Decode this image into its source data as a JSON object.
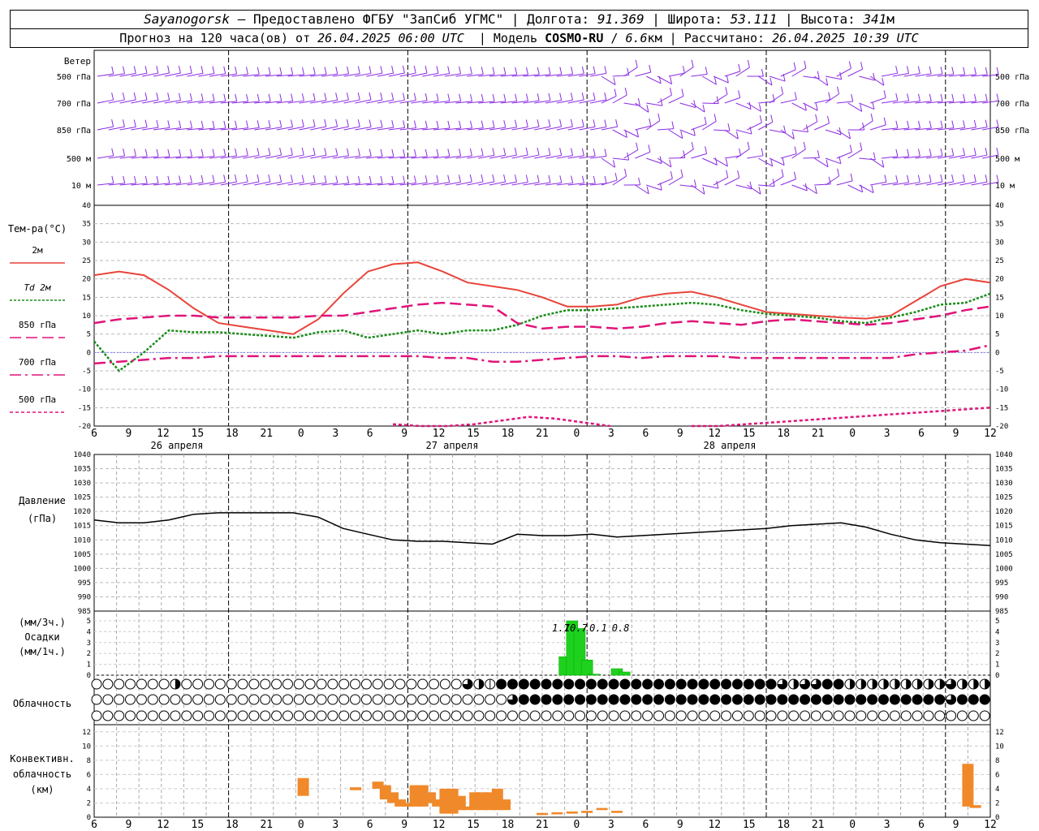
{
  "header": {
    "station": "Sayanogorsk",
    "dash": " — ",
    "provider": "Предоставлено ФГБУ \"ЗапСиб УГМС\"",
    "lon_label": "Долгота: ",
    "lon": "91.369",
    "lat_label": "Широта: ",
    "lat": "53.111",
    "alt_label": "Высота: ",
    "alt": "341",
    "alt_unit": "м",
    "forecast_prefix": "Прогноз на 120 часа(ов) от ",
    "init_time": "26.04.2025 06:00 UTC",
    "model_label": "Модель ",
    "model": "COSMO-RU",
    "resolution": "6.6",
    "res_unit": "км",
    "calc_label": "Рассчитано: ",
    "calc_time": "26.04.2025 10:39 UTC"
  },
  "chart_data": [
    {
      "type": "wind_barbs",
      "title": "Ветер",
      "levels": [
        "500 гПа",
        "700 гПа",
        "850 гПа",
        "500 м",
        "10  м"
      ],
      "color": "#8a2be2"
    },
    {
      "type": "line",
      "title": "Тем-ра(°C)",
      "ylim": [
        -20,
        40
      ],
      "y_ticks": [
        -20,
        -15,
        -10,
        -5,
        0,
        5,
        10,
        15,
        20,
        25,
        30,
        35,
        40
      ],
      "x_hours": [
        0,
        3,
        6,
        9,
        12,
        15,
        18,
        21,
        24,
        27,
        30,
        33,
        36,
        39,
        42,
        45,
        48,
        51,
        54,
        57,
        60,
        63,
        66,
        69,
        72,
        75,
        78,
        81,
        84,
        87,
        90,
        93,
        96,
        99,
        102,
        105,
        108,
        111,
        114,
        117,
        120
      ],
      "x_tick_labels": [
        "6",
        "9",
        "12",
        "15",
        "18",
        "21",
        "0",
        "3",
        "6",
        "9",
        "12",
        "15",
        "18",
        "21",
        "0",
        "3",
        "6",
        "9",
        "12",
        "15",
        "18",
        "21",
        "0",
        "3",
        "6",
        "9",
        "12"
      ],
      "date_labels": [
        "26 апреля",
        "27 апреля",
        "28 апреля"
      ],
      "series": [
        {
          "name": "2м",
          "color": "#e8443a",
          "style": "solid",
          "values": [
            21,
            22,
            21,
            17,
            12,
            8,
            7,
            6,
            5,
            9,
            16,
            22,
            24,
            24.5,
            22,
            19,
            18,
            17,
            15,
            12.5,
            12.5,
            13,
            15,
            16,
            16.5,
            15,
            13,
            11,
            10.5,
            10,
            9.5,
            9.2,
            10,
            14,
            18,
            20,
            19
          ]
        },
        {
          "name": "Td  2м",
          "color": "#1a8c1a",
          "style": "dotted",
          "values": [
            3,
            -5,
            0,
            6,
            5.5,
            5.5,
            5,
            4.5,
            4,
            5.5,
            6,
            4,
            5,
            6,
            5,
            6,
            6,
            7.5,
            10,
            11.5,
            11.5,
            12,
            12.5,
            13,
            13.5,
            13,
            11.5,
            10.5,
            10,
            9.5,
            8.5,
            8,
            9.5,
            11,
            13,
            13.5,
            16
          ]
        },
        {
          "name": "850 гПа",
          "color": "#e0147a",
          "style": "dashed",
          "values": [
            8,
            9,
            9.5,
            10,
            10,
            9.5,
            9.5,
            9.5,
            9.5,
            10,
            10,
            11,
            12,
            13,
            13.5,
            13,
            12.5,
            8,
            6.5,
            7,
            7,
            6.5,
            7,
            8,
            8.5,
            8,
            7.5,
            8.5,
            9,
            8.5,
            8,
            7.5,
            8,
            9,
            10,
            11.5,
            12.5
          ]
        },
        {
          "name": "700 гПа",
          "color": "#e0147a",
          "style": "dashdot",
          "values": [
            -3,
            -2.5,
            -2,
            -1.5,
            -1.5,
            -1,
            -1,
            -1,
            -1,
            -1,
            -1,
            -1,
            -1,
            -1,
            -1.5,
            -1.5,
            -2.5,
            -2.5,
            -2,
            -1.5,
            -1,
            -1,
            -1.5,
            -1,
            -1,
            -1,
            -1.5,
            -1.5,
            -1.5,
            -1.5,
            -1.5,
            -1.5,
            -1.5,
            -0.5,
            0,
            0.5,
            2
          ]
        },
        {
          "name": "500 гПа",
          "color": "#e0147a",
          "style": "dense-dashed",
          "values": [
            null,
            null,
            null,
            null,
            null,
            null,
            null,
            null,
            null,
            null,
            null,
            -19.5,
            -20,
            -20,
            -19.5,
            -18.5,
            -17.5,
            -18,
            -19,
            -20,
            null,
            null,
            -20,
            -20,
            -19.5,
            -19,
            -18.5,
            -18,
            -17.5,
            -17,
            -16.5,
            -16,
            -15.5,
            -15
          ]
        }
      ]
    },
    {
      "type": "line",
      "title": "Давление",
      "unit": "(гПа)",
      "ylim": [
        985,
        1040
      ],
      "y_ticks": [
        985,
        990,
        995,
        1000,
        1005,
        1010,
        1015,
        1020,
        1025,
        1030,
        1035,
        1040
      ],
      "series": [
        {
          "name": "",
          "color": "#000000",
          "values": [
            1017,
            1016,
            1016,
            1017,
            1019,
            1019.5,
            1019.5,
            1019.5,
            1019.5,
            1018,
            1014,
            1012,
            1010,
            1009.5,
            1009.5,
            1009,
            1008.5,
            1012,
            1011.5,
            1011.5,
            1012,
            1011,
            1011.5,
            1012,
            1012.5,
            1013,
            1013.5,
            1014,
            1015,
            1015.5,
            1016,
            1014.5,
            1012,
            1010,
            1009,
            1008.5,
            1008
          ]
        }
      ]
    },
    {
      "type": "bar",
      "title": "Осадки",
      "unit_top": "(мм/3ч.)",
      "unit_bottom": "(мм/1ч.)",
      "ylim": [
        0,
        5
      ],
      "y_ticks": [
        0,
        1,
        2,
        3,
        4,
        5
      ],
      "color": "#1ed11e",
      "bars": [
        {
          "hour": 63,
          "value": 1.7
        },
        {
          "hour": 64,
          "value": 5.0
        },
        {
          "hour": 65,
          "value": 4.3
        },
        {
          "hour": 66,
          "value": 1.4
        },
        {
          "hour": 67,
          "value": 0.1
        },
        {
          "hour": 70,
          "value": 0.6
        },
        {
          "hour": 71,
          "value": 0.3
        }
      ],
      "totals": [
        {
          "hour": 62.5,
          "text": "1.7"
        },
        {
          "hour": 64.5,
          "text": "10.7"
        },
        {
          "hour": 67.5,
          "text": "0.1"
        },
        {
          "hour": 70.5,
          "text": "0.8"
        }
      ]
    },
    {
      "type": "cloud_symbols",
      "title": "Облачность",
      "rows": 3,
      "symbols_per_row": 80,
      "cover": [
        [
          0,
          0,
          0,
          0,
          0,
          0,
          0,
          0,
          0,
          0,
          0,
          2,
          0,
          0,
          0,
          0,
          0,
          0,
          0,
          0,
          0,
          0,
          0,
          0,
          0,
          0,
          0,
          0,
          0,
          0,
          0,
          0,
          0,
          0,
          0,
          0,
          0,
          0,
          0,
          0,
          0,
          0,
          0,
          0,
          0,
          0,
          0,
          0,
          0,
          0,
          0,
          3,
          2,
          3,
          1,
          4,
          4,
          4,
          4,
          4,
          4,
          4,
          4,
          4,
          4,
          4,
          4,
          4,
          4,
          4,
          4,
          4,
          4,
          4,
          4,
          4,
          4,
          4,
          4,
          4,
          4,
          4,
          4,
          4,
          4,
          4,
          4,
          4,
          4,
          4,
          4,
          4,
          4,
          3,
          2,
          2,
          3,
          2,
          3,
          2,
          4,
          4,
          4,
          2,
          2,
          2,
          2,
          2,
          2,
          2,
          2,
          2,
          2,
          2,
          2,
          2,
          3,
          2,
          2,
          2,
          2,
          2
        ],
        [
          0,
          0,
          0,
          0,
          0,
          0,
          0,
          0,
          0,
          0,
          0,
          0,
          0,
          0,
          0,
          0,
          0,
          0,
          0,
          0,
          0,
          0,
          0,
          0,
          0,
          0,
          0,
          0,
          0,
          0,
          0,
          0,
          0,
          0,
          0,
          0,
          0,
          0,
          0,
          0,
          0,
          0,
          0,
          0,
          0,
          0,
          0,
          0,
          0,
          0,
          0,
          0,
          0,
          0,
          0,
          0,
          2,
          0,
          0,
          3,
          4,
          4,
          4,
          4,
          4,
          4,
          4,
          4,
          4,
          4,
          4,
          4,
          4,
          4,
          4,
          4,
          4,
          4,
          4,
          4,
          4,
          4,
          4,
          4,
          4,
          4,
          4,
          4,
          4,
          4,
          4,
          4,
          4,
          4,
          4,
          4,
          4,
          4,
          4,
          4,
          4,
          4,
          4,
          4,
          4,
          3,
          4,
          4,
          4,
          4,
          4,
          4,
          4,
          4,
          4,
          4,
          4,
          4,
          4,
          4,
          3,
          4,
          4,
          4,
          4,
          4
        ],
        [
          0,
          0,
          0,
          0,
          0,
          0,
          0,
          0,
          0,
          0,
          0,
          0,
          0,
          0,
          0,
          0,
          0,
          0,
          0,
          0,
          0,
          0,
          0,
          0,
          0,
          0,
          0,
          0,
          0,
          0,
          0,
          0,
          0,
          0,
          0,
          0,
          0,
          0,
          0,
          0,
          0,
          0,
          0,
          0,
          0,
          0,
          0,
          0,
          0,
          0,
          0,
          0,
          0,
          0,
          0,
          0,
          0,
          0,
          0,
          0,
          0,
          0,
          0,
          0,
          0,
          0,
          0,
          0,
          0,
          0,
          0,
          0,
          0,
          0,
          0,
          0,
          0,
          0,
          0,
          0,
          0,
          0,
          0,
          0,
          0,
          0,
          0,
          0,
          0,
          0,
          0,
          0,
          0,
          0,
          0,
          0,
          0,
          0,
          0,
          0,
          0,
          0,
          0,
          0,
          0,
          0,
          0,
          0,
          0,
          0,
          0,
          0,
          0,
          0,
          0,
          0,
          0,
          0,
          0,
          0
        ]
      ]
    },
    {
      "type": "bar",
      "title": "Конвективн. облачность",
      "unit": "(км)",
      "ylim": [
        0,
        13
      ],
      "y_ticks": [
        0,
        2,
        4,
        6,
        8,
        10,
        12
      ],
      "color": "#f0892a",
      "ranges": [
        {
          "hour": 28,
          "base": 3,
          "top": 5.5
        },
        {
          "hour": 35,
          "base": 3.8,
          "top": 4.2
        },
        {
          "hour": 38,
          "base": 4,
          "top": 5
        },
        {
          "hour": 39,
          "base": 2.5,
          "top": 4.5
        },
        {
          "hour": 40,
          "base": 2,
          "top": 3.5
        },
        {
          "hour": 41,
          "base": 1.5,
          "top": 2.5
        },
        {
          "hour": 42,
          "base": 1.5,
          "top": 2
        },
        {
          "hour": 43,
          "base": 1.5,
          "top": 4.5
        },
        {
          "hour": 44,
          "base": 1.5,
          "top": 4.5
        },
        {
          "hour": 45,
          "base": 2,
          "top": 3.5
        },
        {
          "hour": 46,
          "base": 1.5,
          "top": 2.5
        },
        {
          "hour": 47,
          "base": 0.5,
          "top": 4
        },
        {
          "hour": 48,
          "base": 0.5,
          "top": 4
        },
        {
          "hour": 49,
          "base": 1,
          "top": 3
        },
        {
          "hour": 50,
          "base": 1,
          "top": 1.5
        },
        {
          "hour": 51,
          "base": 1,
          "top": 3.5
        },
        {
          "hour": 52,
          "base": 1,
          "top": 3.5
        },
        {
          "hour": 53,
          "base": 1,
          "top": 3.5
        },
        {
          "hour": 54,
          "base": 1,
          "top": 4
        },
        {
          "hour": 55,
          "base": 1,
          "top": 2.5
        },
        {
          "hour": 60,
          "base": 0.3,
          "top": 0.6
        },
        {
          "hour": 62,
          "base": 0.4,
          "top": 0.7
        },
        {
          "hour": 64,
          "base": 0.5,
          "top": 0.8
        },
        {
          "hour": 66,
          "base": 0.6,
          "top": 0.9
        },
        {
          "hour": 68,
          "base": 1,
          "top": 1.3
        },
        {
          "hour": 70,
          "base": 0.6,
          "top": 0.9
        },
        {
          "hour": 117,
          "base": 1.5,
          "top": 7.5
        },
        {
          "hour": 118,
          "base": 1.3,
          "top": 1.7
        }
      ]
    }
  ]
}
